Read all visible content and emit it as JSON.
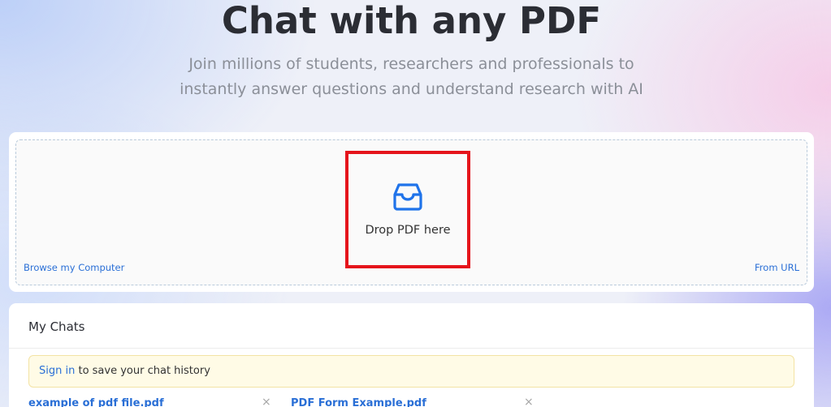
{
  "hero": {
    "title": "Chat with any PDF",
    "subtitle_line1": "Join millions of students, researchers and professionals to",
    "subtitle_line2": "instantly answer questions and understand research with AI"
  },
  "upload": {
    "icon": "inbox-icon",
    "drop_label": "Drop PDF here",
    "browse_label": "Browse my Computer",
    "url_label": "From URL",
    "accent_color": "#2a6fd6",
    "highlight_color": "#e5141b"
  },
  "chats": {
    "title": "My Chats",
    "signin_link": "Sign in",
    "signin_text": " to save your chat history",
    "items": [
      {
        "name": "example of pdf file.pdf",
        "remove": "×"
      },
      {
        "name": "PDF Form Example.pdf",
        "remove": "×"
      }
    ]
  }
}
